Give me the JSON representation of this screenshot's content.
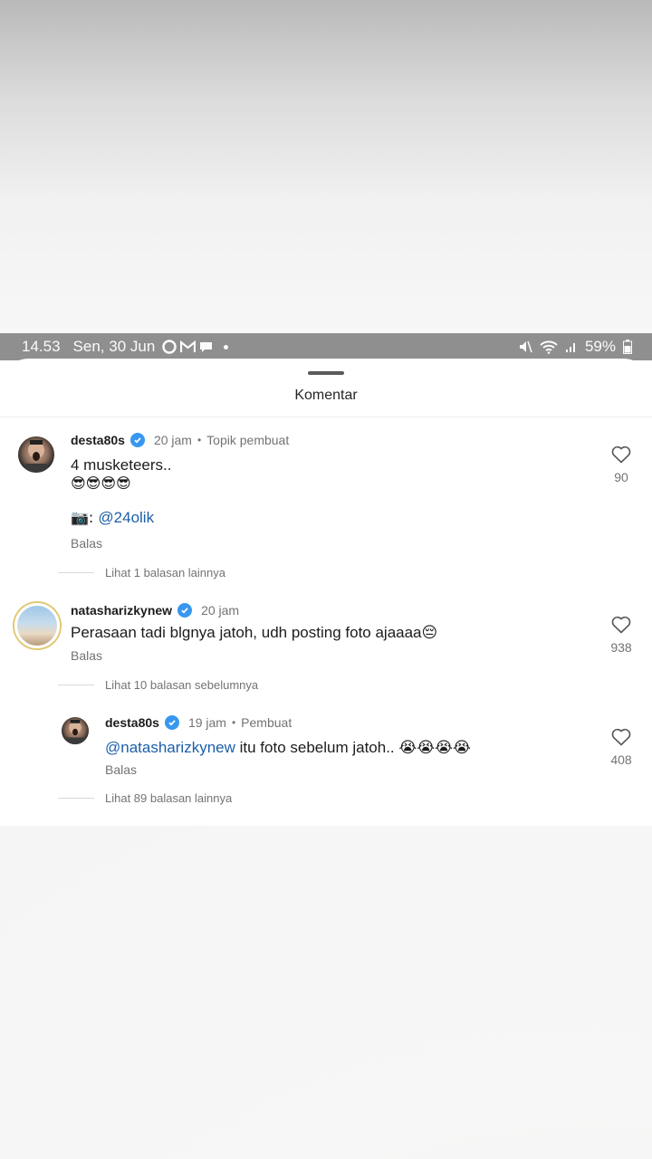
{
  "status_bar": {
    "time": "14.53",
    "date": "Sen, 30 Jun",
    "battery": "59%"
  },
  "sheet": {
    "title": "Komentar"
  },
  "comments": [
    {
      "username": "desta80s",
      "time": "20 jam",
      "tag": "Topik pembuat",
      "text_line1": "4 musketeers..",
      "text_line2": "😎😎😎😎",
      "text_line3_prefix": "📷: ",
      "text_line3_mention": "@24olik",
      "reply_label": "Balas",
      "likes": "90",
      "more_label": "Lihat 1 balasan lainnya"
    },
    {
      "username": "natasharizkynew",
      "time": "20 jam",
      "text": "Perasaan tadi blgnya jatoh, udh posting foto ajaaaa😔",
      "reply_label": "Balas",
      "likes": "938",
      "prev_label": "Lihat 10 balasan sebelumnya"
    },
    {
      "username": "desta80s",
      "time": "19 jam",
      "tag": "Pembuat",
      "mention": "@natasharizkynew",
      "text": " itu foto sebelum jatoh.. 😭😭😭😭",
      "reply_label": "Balas",
      "likes": "408",
      "more_label": "Lihat 89 balasan lainnya"
    }
  ],
  "icons": [
    "signal-icon",
    "wifi-icon",
    "battery-icon",
    "heart-icon",
    "verified-icon"
  ],
  "colors": {
    "status_bar_bg": "#8f8f8f",
    "verified_blue": "#3897f0",
    "mention_blue": "#1d5fa8"
  }
}
